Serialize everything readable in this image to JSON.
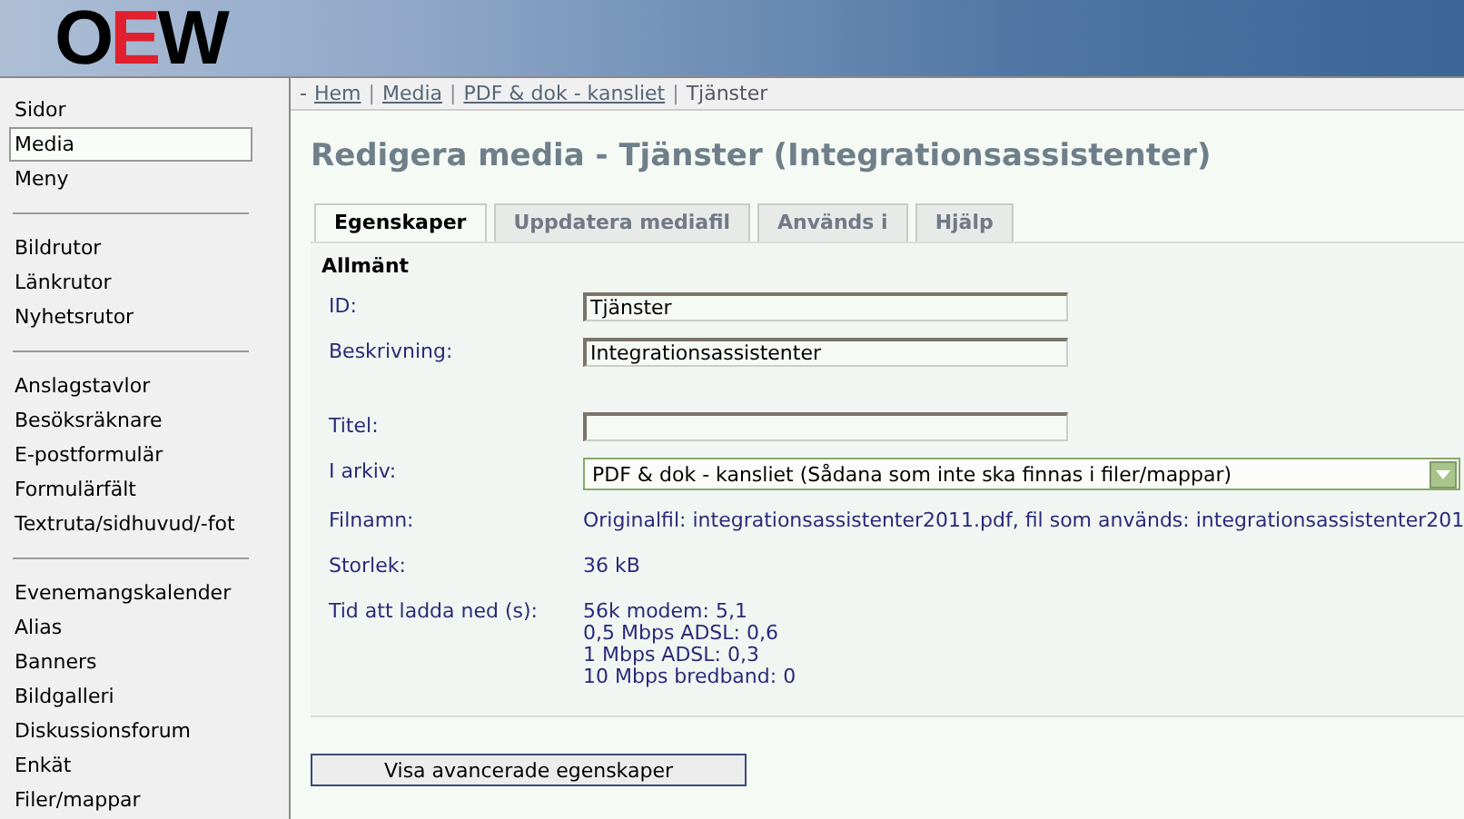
{
  "header": {
    "logo": [
      {
        "char": "O",
        "color": "#000000"
      },
      {
        "char": "E",
        "color": "#e0202e"
      },
      {
        "char": "W",
        "color": "#000000"
      }
    ]
  },
  "sidebar": {
    "groups": [
      [
        {
          "label": "Sidor",
          "selected": false
        },
        {
          "label": "Media",
          "selected": true
        },
        {
          "label": "Meny",
          "selected": false
        }
      ],
      [
        {
          "label": "Bildrutor",
          "selected": false
        },
        {
          "label": "Länkrutor",
          "selected": false
        },
        {
          "label": "Nyhetsrutor",
          "selected": false
        }
      ],
      [
        {
          "label": "Anslagstavlor",
          "selected": false
        },
        {
          "label": "Besöksräknare",
          "selected": false
        },
        {
          "label": "E-postformulär",
          "selected": false
        },
        {
          "label": "Formulärfält",
          "selected": false
        },
        {
          "label": "Textruta/sidhuvud/-fot",
          "selected": false
        }
      ],
      [
        {
          "label": "Evenemangskalender",
          "selected": false
        },
        {
          "label": "Alias",
          "selected": false
        },
        {
          "label": "Banners",
          "selected": false
        },
        {
          "label": "Bildgalleri",
          "selected": false
        },
        {
          "label": "Diskussionsforum",
          "selected": false
        },
        {
          "label": "Enkät",
          "selected": false
        },
        {
          "label": "Filer/mappar",
          "selected": false
        }
      ]
    ]
  },
  "breadcrumb": {
    "lead": "-",
    "separator": "|",
    "links": [
      "Hem",
      "Media",
      "PDF & dok - kansliet"
    ],
    "current": "Tjänster"
  },
  "title": "Redigera media - Tjänster (Integrationsassistenter)",
  "tabs": [
    {
      "label": "Egenskaper",
      "selected": true
    },
    {
      "label": "Uppdatera mediafil",
      "selected": false
    },
    {
      "label": "Används i",
      "selected": false
    },
    {
      "label": "Hjälp",
      "selected": false
    }
  ],
  "section": {
    "heading": "Allmänt",
    "rows": [
      {
        "kind": "input",
        "label": "ID:",
        "value": "Tjänster"
      },
      {
        "kind": "input",
        "label": "Beskrivning:",
        "value": "Integrationsassistenter"
      },
      {
        "kind": "input",
        "label": "Titel:",
        "value": ""
      },
      {
        "kind": "select",
        "label": "I arkiv:",
        "value": "PDF & dok - kansliet (Sådana som inte ska finnas i filer/mappar)"
      },
      {
        "kind": "text",
        "label": "Filnamn:",
        "lines": [
          "Originalfil: integrationsassistenter2011.pdf, fil som används: integrationsassistenter201"
        ]
      },
      {
        "kind": "text",
        "label": "Storlek:",
        "lines": [
          "36 kB"
        ]
      },
      {
        "kind": "text",
        "label": "Tid att ladda ned (s):",
        "lines": [
          "56k modem: 5,1",
          "0,5 Mbps ADSL: 0,6",
          "1 Mbps ADSL: 0,3",
          "10 Mbps bredband: 0"
        ]
      }
    ]
  },
  "advanced_button": "Visa avancerade egenskaper"
}
